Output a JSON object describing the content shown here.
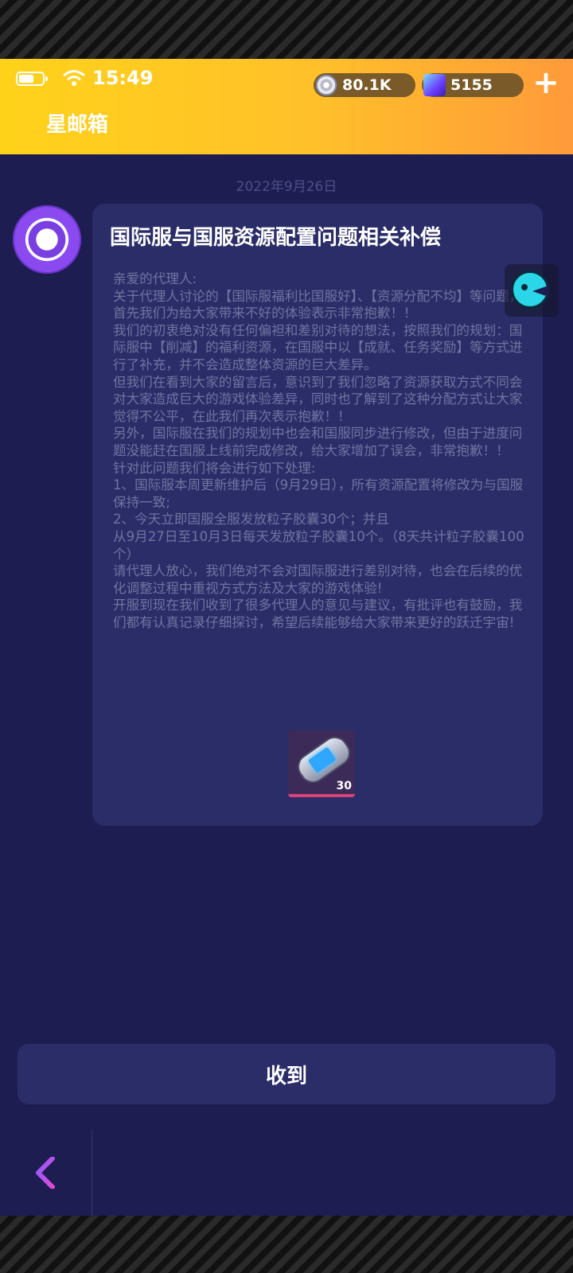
{
  "status_bar": {
    "time": "15:49",
    "icons": [
      "battery-icon",
      "wifi-icon"
    ]
  },
  "currency": {
    "coins": "80.1K",
    "gems": "5155",
    "add_label": "+"
  },
  "header": {
    "title": "星邮箱"
  },
  "mail": {
    "date": "2022年9月26日",
    "title": "国际服与国服资源配置问题相关补偿",
    "body": [
      "亲爱的代理人:",
      "关于代理人讨论的【国际服福利比国服好】、【资源分配不均】等问题，首先我们为给大家带来不好的体验表示非常抱歉！！",
      "我们的初衷绝对没有任何偏袒和差别对待的想法，按照我们的规划：国际服中【削减】的福利资源，在国服中以【成就、任务奖励】等方式进行了补充，并不会造成整体资源的巨大差异。",
      "但我们在看到大家的留言后，意识到了我们忽略了资源获取方式不同会对大家造成巨大的游戏体验差异，同时也了解到了这种分配方式让大家觉得不公平，在此我们再次表示抱歉！！",
      "另外，国际服在我们的规划中也会和国服同步进行修改，但由于进度问题没能赶在国服上线前完成修改，给大家增加了误会，非常抱歉！！",
      "针对此问题我们将会进行如下处理:",
      "1、国际服本周更新维护后（9月29日），所有资源配置将修改为与国服保持一致;",
      "2、今天立即国服全服发放粒子胶囊30个；并且",
      "从9月27日至10月3日每天发放粒子胶囊10个。（8天共计粒子胶囊100个）",
      "请代理人放心，我们绝对不会对国际服进行差别对待，也会在后续的优化调整过程中重视方式方法及大家的游戏体验!",
      "开服到现在我们收到了很多代理人的意见与建议，有批评也有鼓励，我们都有认真记录仔细探讨，希望后续能够给大家带来更好的跃迁宇宙!"
    ],
    "attachment": {
      "icon": "particle-capsule-icon",
      "count": "30"
    }
  },
  "actions": {
    "confirm_label": "收到"
  },
  "colors": {
    "header_start": "#ffd21a",
    "header_end": "#ff9a3a",
    "background": "#1d1d52",
    "card": "#2b2d69",
    "body_text": "#70749e",
    "accent": "#b44de6"
  }
}
